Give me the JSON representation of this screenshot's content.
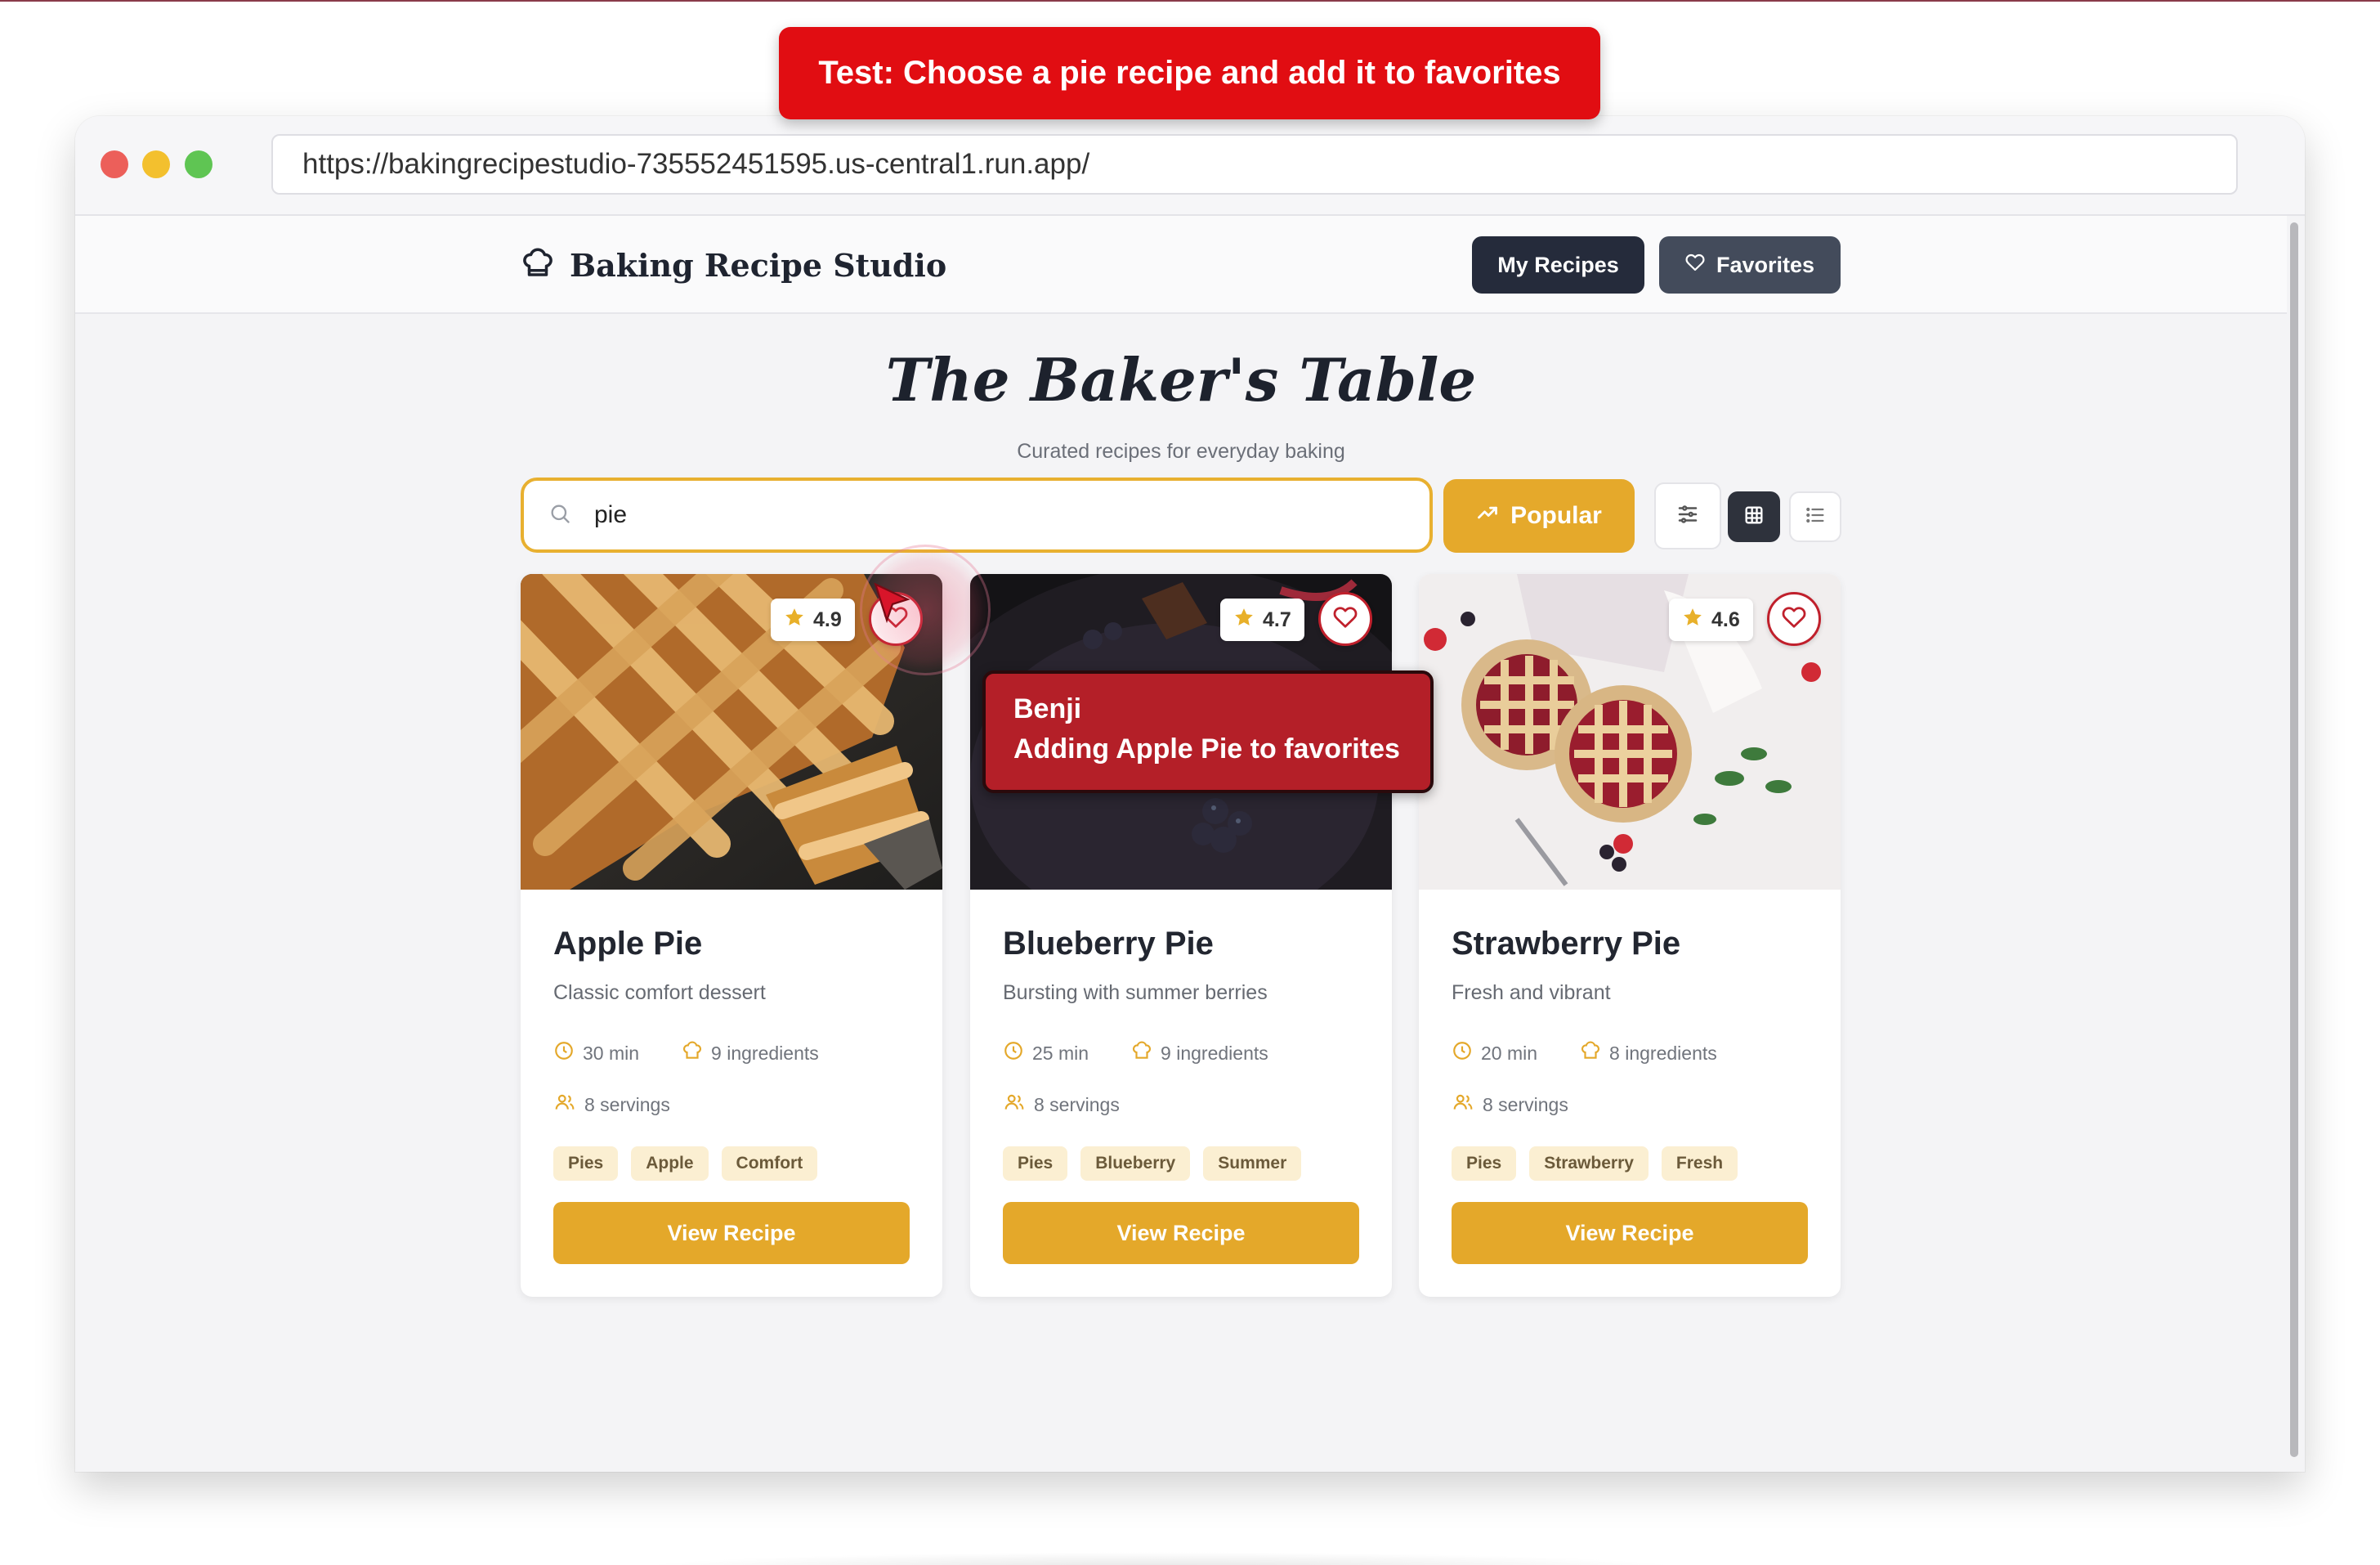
{
  "test_banner": "Test: Choose a pie recipe and add it to favorites",
  "browser": {
    "url": "https://bakingrecipestudio-735552451595.us-central1.run.app/"
  },
  "nav": {
    "brand": "Baking Recipe Studio",
    "my_recipes": "My Recipes",
    "favorites": "Favorites"
  },
  "hero": {
    "title": "The Baker's Table",
    "subtitle": "Curated recipes for everyday baking"
  },
  "search": {
    "value": "pie"
  },
  "toolbar": {
    "sort_label": "Popular",
    "active_view": "grid"
  },
  "recipes": [
    {
      "title": "Apple Pie",
      "description": "Classic comfort dessert",
      "rating": "4.9",
      "time": "30 min",
      "ingredients": "9 ingredients",
      "servings": "8 servings",
      "tags": [
        "Pies",
        "Apple",
        "Comfort"
      ],
      "button": "View Recipe"
    },
    {
      "title": "Blueberry Pie",
      "description": "Bursting with summer berries",
      "rating": "4.7",
      "time": "25 min",
      "ingredients": "9 ingredients",
      "servings": "8 servings",
      "tags": [
        "Pies",
        "Blueberry",
        "Summer"
      ],
      "button": "View Recipe"
    },
    {
      "title": "Strawberry Pie",
      "description": "Fresh and vibrant",
      "rating": "4.6",
      "time": "20 min",
      "ingredients": "8 ingredients",
      "servings": "8 servings",
      "tags": [
        "Pies",
        "Strawberry",
        "Fresh"
      ],
      "button": "View Recipe"
    }
  ],
  "agent_tooltip": {
    "name": "Benji",
    "message": "Adding Apple Pie to favorites"
  },
  "colors": {
    "accent": "#e4a82a",
    "favorite": "#c0202c",
    "banner": "#e10d12",
    "dark_button": "#252b3b"
  }
}
